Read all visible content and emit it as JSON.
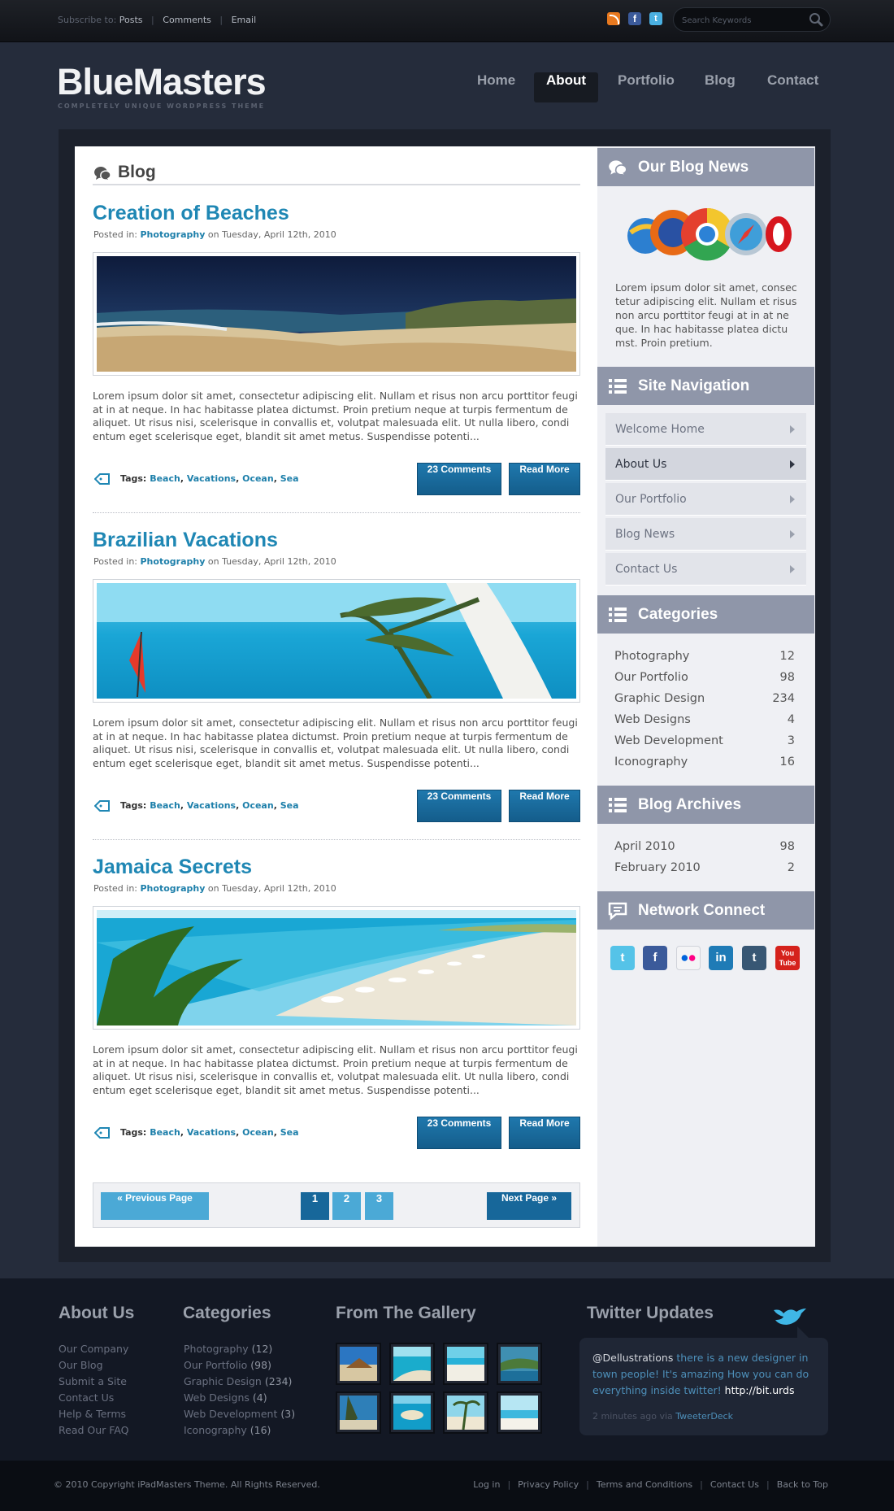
{
  "topbar": {
    "subscribe_label": "Subscribe to:",
    "links": [
      "Posts",
      "Comments",
      "Email"
    ],
    "search_placeholder": "Search Keywords"
  },
  "header": {
    "logo": "BlueMasters",
    "tagline": "COMPLETELY UNIQUE WORDPRESS THEME",
    "nav": [
      "Home",
      "About",
      "Portfolio",
      "Blog",
      "Contact"
    ],
    "active_nav": "About"
  },
  "main": {
    "heading": "Blog",
    "posts": [
      {
        "title": "Creation of Beaches",
        "meta_prefix": "Posted in:",
        "category": "Photography",
        "date": "on Tuesday, April 12th, 2010",
        "excerpt": "Lorem ipsum dolor sit amet, consectetur adipiscing elit. Nullam et risus non arcu porttitor feugi at in at neque. In hac habitasse platea dictumst. Proin pretium neque at turpis fermentum de aliquet. Ut risus nisi, scelerisque in convallis et, volutpat malesuada elit. Ut nulla libero, condi entum eget scelerisque eget, blandit sit amet metus. Suspendisse potenti...",
        "tags_label": "Tags:",
        "tags": [
          "Beach",
          "Vacations",
          "Ocean",
          "Sea"
        ],
        "comments": "23 Comments",
        "read_more": "Read More"
      },
      {
        "title": "Brazilian Vacations",
        "meta_prefix": "Posted in:",
        "category": "Photography",
        "date": "on Tuesday, April 12th, 2010",
        "excerpt": "Lorem ipsum dolor sit amet, consectetur adipiscing elit. Nullam et risus non arcu porttitor feugi at in at neque. In hac habitasse platea dictumst. Proin pretium neque at turpis fermentum de aliquet. Ut risus nisi, scelerisque in convallis et, volutpat malesuada elit. Ut nulla libero, condi entum eget scelerisque eget, blandit sit amet metus. Suspendisse potenti...",
        "tags_label": "Tags:",
        "tags": [
          "Beach",
          "Vacations",
          "Ocean",
          "Sea"
        ],
        "comments": "23 Comments",
        "read_more": "Read More"
      },
      {
        "title": "Jamaica Secrets",
        "meta_prefix": "Posted in:",
        "category": "Photography",
        "date": "on Tuesday, April 12th, 2010",
        "excerpt": "Lorem ipsum dolor sit amet, consectetur adipiscing elit. Nullam et risus non arcu porttitor feugi at in at neque. In hac habitasse platea dictumst. Proin pretium neque at turpis fermentum de aliquet. Ut risus nisi, scelerisque in convallis et, volutpat malesuada elit. Ut nulla libero, condi entum eget scelerisque eget, blandit sit amet metus. Suspendisse potenti...",
        "tags_label": "Tags:",
        "tags": [
          "Beach",
          "Vacations",
          "Ocean",
          "Sea"
        ],
        "comments": "23 Comments",
        "read_more": "Read More"
      }
    ],
    "pagination": {
      "prev": "« Previous Page",
      "pages": [
        "1",
        "2",
        "3"
      ],
      "current": "1",
      "next": "Next Page »"
    }
  },
  "sidebar": {
    "blog_news": {
      "title": "Our Blog News",
      "text": "Lorem ipsum dolor sit amet, consec tetur adipiscing elit. Nullam et risus non arcu porttitor feugi at in at ne que. In hac habitasse platea dictu mst. Proin pretium."
    },
    "site_nav": {
      "title": "Site Navigation",
      "items": [
        "Welcome Home",
        "About Us",
        "Our Portfolio",
        "Blog News",
        "Contact Us"
      ],
      "active": "About Us"
    },
    "categories": {
      "title": "Categories",
      "items": [
        {
          "name": "Photography",
          "count": "12"
        },
        {
          "name": "Our Portfolio",
          "count": "98"
        },
        {
          "name": "Graphic Design",
          "count": "234"
        },
        {
          "name": "Web Designs",
          "count": "4"
        },
        {
          "name": "Web Development",
          "count": "3"
        },
        {
          "name": "Iconography",
          "count": "16"
        }
      ]
    },
    "archives": {
      "title": "Blog Archives",
      "items": [
        {
          "name": "April 2010",
          "count": "98"
        },
        {
          "name": "February 2010",
          "count": "2"
        }
      ]
    },
    "network": {
      "title": "Network Connect",
      "icons": [
        "twitter-icon",
        "facebook-icon",
        "flickr-icon",
        "linkedin-icon",
        "tumblr-icon",
        "youtube-icon"
      ]
    }
  },
  "footer": {
    "about": {
      "title": "About Us",
      "links": [
        "Our Company",
        "Our Blog",
        "Submit a Site",
        "Contact Us",
        "Help & Terms",
        "Read Our FAQ"
      ]
    },
    "categories": {
      "title": "Categories",
      "items": [
        {
          "name": "Photography",
          "count": "(12)"
        },
        {
          "name": "Our Portfolio",
          "count": "(98)"
        },
        {
          "name": "Graphic Design",
          "count": "(234)"
        },
        {
          "name": "Web Designs",
          "count": "(4)"
        },
        {
          "name": "Web Development",
          "count": "(3)"
        },
        {
          "name": "Iconography",
          "count": "(16)"
        }
      ]
    },
    "gallery": {
      "title": "From The Gallery"
    },
    "twitter": {
      "title": "Twitter Updates",
      "user": "@Dellustrations",
      "text": " there is a new designer in town people! It's amazing How you can do everything inside twitter! ",
      "link": "http://bit.urds",
      "time": "2 minutes ago via ",
      "via": "TweeterDeck"
    },
    "copyright": "© 2010 Copyright iPadMasters Theme. All Rights Reserved.",
    "bottom_links": [
      "Log in",
      "Privacy Policy",
      "Terms and Conditions",
      "Contact Us",
      "Back to Top"
    ]
  },
  "colors": {
    "accent_blue": "#1f87b4",
    "button_blue": "#17679a",
    "sidebar_header": "#8f96a9",
    "page_background": "#252c3b"
  }
}
